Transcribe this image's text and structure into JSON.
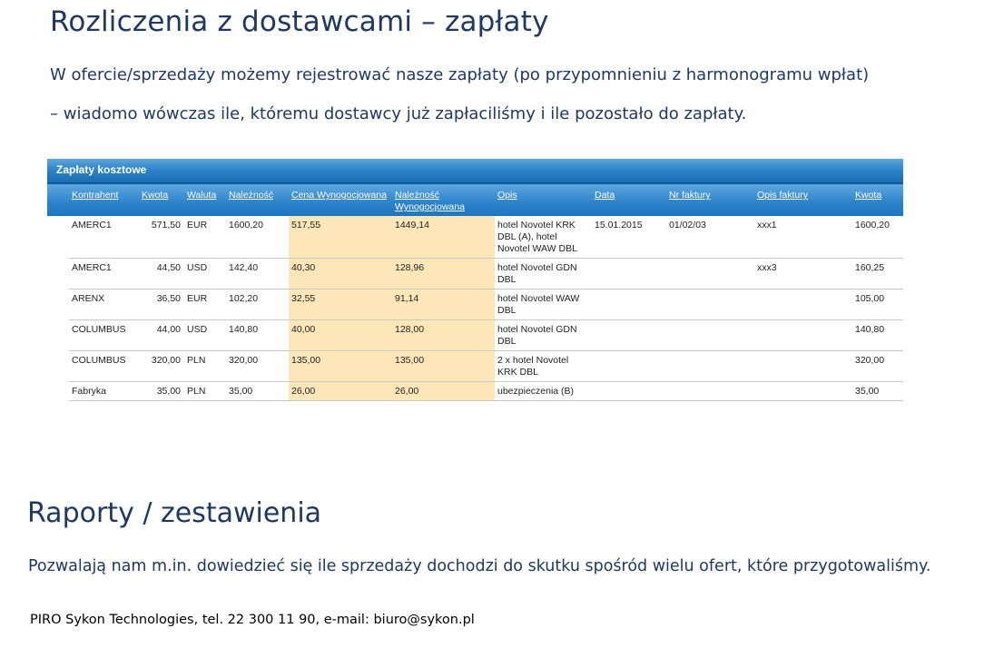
{
  "heading1": "Rozliczenia z dostawcami – zapłaty",
  "para1": "W ofercie/sprzedaży możemy rejestrować nasze zapłaty (po przypomnieniu z harmonogramu wpłat)",
  "para2": "– wiadomo wówczas ile, któremu dostawcy już zapłaciliśmy i ile pozostało do zapłaty.",
  "table": {
    "title": "Zapłaty kosztowe",
    "headers": {
      "kontrahent": "Kontrahent",
      "kwota": "Kwota",
      "waluta": "Waluta",
      "naleznosc": "Należność",
      "cena": "Cena Wynogocjowana",
      "naleznosc_wyn": "Należność Wynogocjowana",
      "opis": "Opis",
      "data": "Data",
      "nr_faktury": "Nr faktury",
      "opis_faktury": "Opis faktury",
      "kwota2": "Kwota"
    },
    "rows": [
      {
        "kontrahent": "AMERC1",
        "kwota": "571,50",
        "waluta": "EUR",
        "naleznosc": "1600,20",
        "cena": "517,55",
        "naleznosc_wyn": "1449,14",
        "opis": "hotel Novotel KRK DBL (A), hotel Novotel WAW DBL",
        "data": "15.01.2015",
        "nr_faktury": "01/02/03",
        "opis_faktury": "xxx1",
        "kwota2": "1600,20"
      },
      {
        "kontrahent": "AMERC1",
        "kwota": "44,50",
        "waluta": "USD",
        "naleznosc": "142,40",
        "cena": "40,30",
        "naleznosc_wyn": "128,96",
        "opis": "hotel Novotel GDN DBL",
        "data": "",
        "nr_faktury": "",
        "opis_faktury": "xxx3",
        "kwota2": "160,25"
      },
      {
        "kontrahent": "ARENX",
        "kwota": "36,50",
        "waluta": "EUR",
        "naleznosc": "102,20",
        "cena": "32,55",
        "naleznosc_wyn": "91,14",
        "opis": "hotel Novotel WAW DBL",
        "data": "",
        "nr_faktury": "",
        "opis_faktury": "",
        "kwota2": "105,00"
      },
      {
        "kontrahent": "COLUMBUS",
        "kwota": "44,00",
        "waluta": "USD",
        "naleznosc": "140,80",
        "cena": "40,00",
        "naleznosc_wyn": "128,00",
        "opis": "hotel Novotel GDN DBL",
        "data": "",
        "nr_faktury": "",
        "opis_faktury": "",
        "kwota2": "140,80"
      },
      {
        "kontrahent": "COLUMBUS",
        "kwota": "320,00",
        "waluta": "PLN",
        "naleznosc": "320,00",
        "cena": "135,00",
        "naleznosc_wyn": "135,00",
        "opis": "2 x hotel Novotel KRK DBL",
        "data": "",
        "nr_faktury": "",
        "opis_faktury": "",
        "kwota2": "320,00"
      },
      {
        "kontrahent": "Fabryka",
        "kwota": "35,00",
        "waluta": "PLN",
        "naleznosc": "35,00",
        "cena": "26,00",
        "naleznosc_wyn": "26,00",
        "opis": "ubezpieczenia (B)",
        "data": "",
        "nr_faktury": "",
        "opis_faktury": "",
        "kwota2": "35,00"
      }
    ]
  },
  "heading2": "Raporty / zestawienia",
  "para3": "Pozwalają nam m.in. dowiedzieć się ile sprzedaży dochodzi do skutku spośród wielu ofert, które przygotowaliśmy.",
  "footer": "PIRO Sykon Technologies, tel. 22 300 11 90, e-mail: biuro@sykon.pl",
  "colors": {
    "title_blue": "#1f3864",
    "header_blue": "#2c82cb",
    "highlight": "#fde6b8"
  }
}
